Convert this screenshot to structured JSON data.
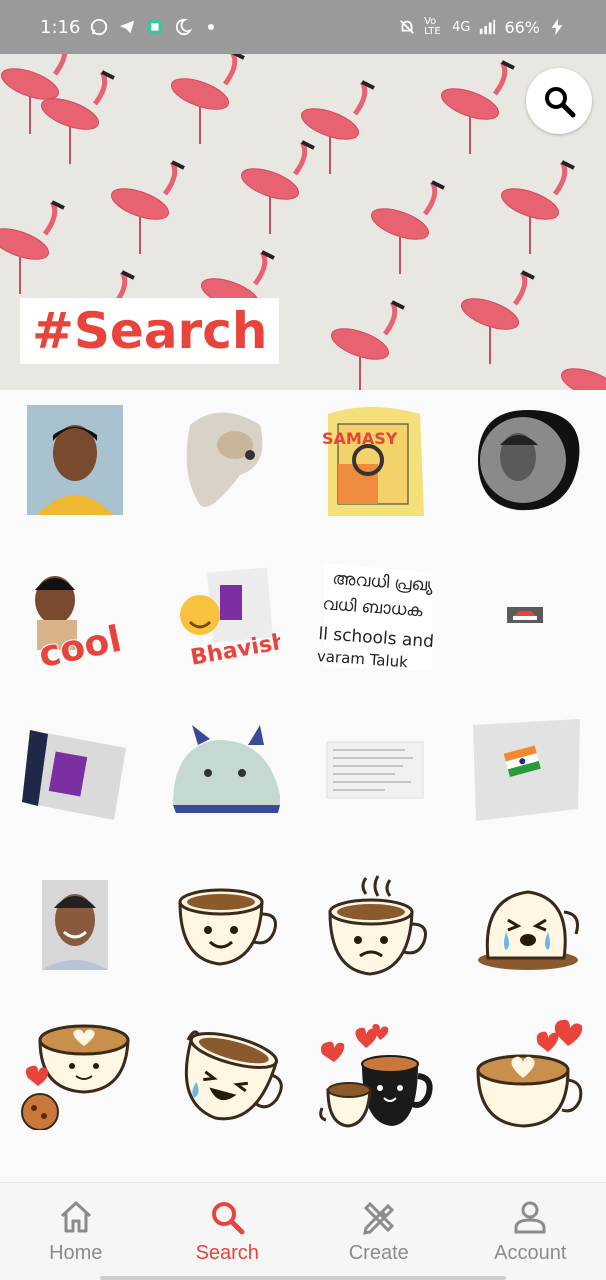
{
  "status_bar": {
    "time": "1:16",
    "battery": "66%",
    "network": "4G",
    "volte": "Vo LTE"
  },
  "banner": {
    "title": "#Search"
  },
  "stickers": [
    {
      "name": "sticker-portrait-yellow-shirt"
    },
    {
      "name": "sticker-dog-face"
    },
    {
      "name": "sticker-notes-paper"
    },
    {
      "name": "sticker-portrait-circle"
    },
    {
      "name": "sticker-cool-boy",
      "text": "cool"
    },
    {
      "name": "sticker-bhavish",
      "text": "Bhavish"
    },
    {
      "name": "sticker-malayalam-text",
      "line1": "അവധി പ്രഖ്യ",
      "line2": "വധി ബാധക",
      "line3": "ll schools and ",
      "line4": "varam Taluk"
    },
    {
      "name": "sticker-car-small"
    },
    {
      "name": "sticker-journal-screen"
    },
    {
      "name": "sticker-bunny-bag"
    },
    {
      "name": "sticker-list-screen"
    },
    {
      "name": "sticker-flag-screen"
    },
    {
      "name": "sticker-portrait-smile"
    },
    {
      "name": "sticker-cup-smile"
    },
    {
      "name": "sticker-cup-sad-steam"
    },
    {
      "name": "sticker-cup-crying"
    },
    {
      "name": "sticker-latte-cookie"
    },
    {
      "name": "sticker-cup-laughing"
    },
    {
      "name": "sticker-mugs-hearts"
    },
    {
      "name": "sticker-latte-hearts"
    }
  ],
  "nav": {
    "items": [
      {
        "label": "Home",
        "icon": "home-icon"
      },
      {
        "label": "Search",
        "icon": "search-icon",
        "active": true
      },
      {
        "label": "Create",
        "icon": "create-icon"
      },
      {
        "label": "Account",
        "icon": "account-icon"
      }
    ]
  },
  "colors": {
    "accent": "#e8443b",
    "inactive": "#8c8c8c",
    "status_bar": "#9a9a9a"
  }
}
